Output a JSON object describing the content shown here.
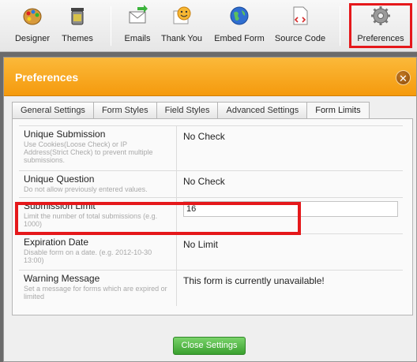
{
  "toolbar": {
    "items": [
      {
        "label": "Designer",
        "icon": "palette-icon"
      },
      {
        "label": "Themes",
        "icon": "paint-bucket-icon"
      },
      {
        "label": "Emails",
        "icon": "email-icon"
      },
      {
        "label": "Thank You",
        "icon": "smiley-icon"
      },
      {
        "label": "Embed Form",
        "icon": "globe-icon"
      },
      {
        "label": "Source Code",
        "icon": "source-code-icon"
      },
      {
        "label": "Preferences",
        "icon": "gear-icon"
      }
    ]
  },
  "modal": {
    "title": "Preferences",
    "close_symbol": "✕",
    "tabs": [
      "General Settings",
      "Form Styles",
      "Field Styles",
      "Advanced Settings",
      "Form Limits"
    ],
    "active_tab": "Form Limits",
    "rows": [
      {
        "title": "Unique Submission",
        "desc": "Use Cookies(Loose Check) or IP Address(Strict Check) to prevent multiple submissions.",
        "value": "No Check"
      },
      {
        "title": "Unique Question",
        "desc": "Do not allow previously entered values.",
        "value": "No Check"
      },
      {
        "title": "Submission Limit",
        "desc": "Limit the number of total submissions (e.g. 1000)",
        "value": "16"
      },
      {
        "title": "Expiration Date",
        "desc": "Disable form on a date. (e.g. 2012-10-30 13:00)",
        "value": "No Limit"
      },
      {
        "title": "Warning Message",
        "desc": "Set a message for forms which are expired or limited",
        "value": "This form is currently unavailable!"
      }
    ],
    "close_button": "Close Settings"
  }
}
